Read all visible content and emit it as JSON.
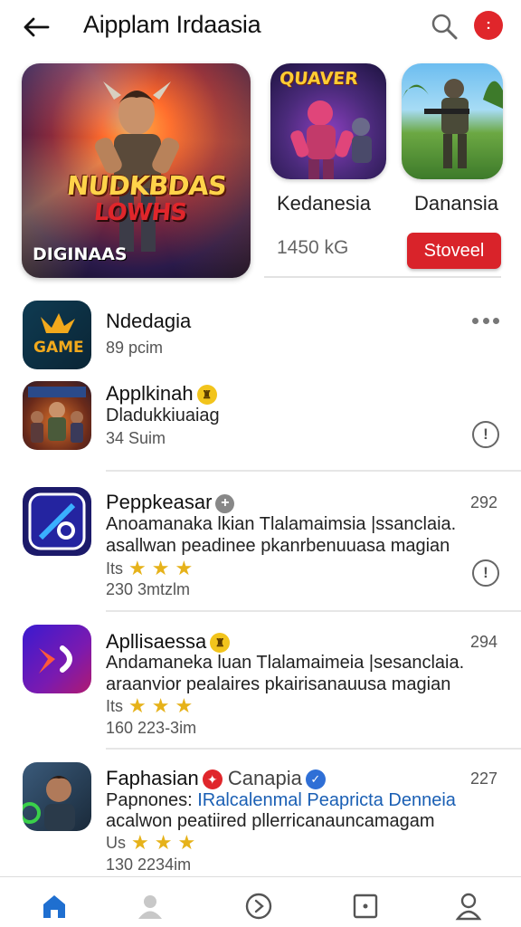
{
  "header": {
    "title": "Aipplam Irdaasia"
  },
  "featured": {
    "main": {
      "logo_line1": "NUDKBDAS",
      "logo_line2": "LOWHS",
      "brand": "DIGINAAS"
    },
    "tiles": [
      {
        "logo": "QUAVER",
        "name": "Kedanesia",
        "price": "1450 kG"
      },
      {
        "name": "Danansia",
        "install_label": "Stoveel"
      }
    ]
  },
  "list": [
    {
      "name": "Ndedagia",
      "meta": "89 pcim",
      "icon_text": "GAME"
    },
    {
      "name": "Applkinah",
      "line1": "Dladukkiuaiag",
      "meta": "34 Suim"
    },
    {
      "name": "Peppkeasar",
      "num": "292",
      "line1": "Anoamanaka lkian Tlalamaimsia |ssanclaia.",
      "line2": "asallwan peadinee pkanrbenuuasa magian",
      "rating_prefix": "Its",
      "meta": "230 3mtzlm"
    },
    {
      "name": "Apllisaessa",
      "num": "294",
      "line1": "Andamaneka luan Tlalamaimeia |sesanclaia.",
      "line2": "araanvior pealaires pkairisanauusa magian",
      "rating_prefix": "Its",
      "meta": "160 223-3im"
    },
    {
      "name": "Faphasian",
      "name2": "Canapia",
      "num": "227",
      "line1_prefix": "Papnones:",
      "line1_link": "IRalcalenmal Peapricta Denneia",
      "line2": "acalwon peatiired pllerricanauncamagam",
      "rating_prefix": "Us",
      "meta": "130 2234im"
    }
  ],
  "nav": [
    "home-icon",
    "person-icon",
    "play-icon",
    "square-icon",
    "account-icon"
  ],
  "colors": {
    "accent": "#d9232a",
    "star": "#e6b21a",
    "nav_active": "#1f6fd0"
  }
}
